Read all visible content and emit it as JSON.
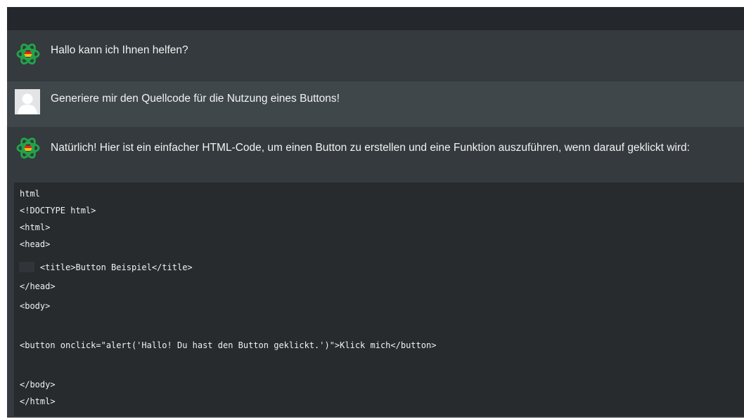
{
  "chat": {
    "messages": [
      {
        "role": "assistant",
        "text": "Hallo kann ich Ihnen helfen?"
      },
      {
        "role": "user",
        "text": "Generiere mir den Quellcode für die Nutzung eines Buttons!"
      },
      {
        "role": "assistant",
        "text": "Natürlich! Hier ist ein einfacher HTML-Code, um einen Button zu erstellen und eine Funktion auszuführen, wenn darauf geklickt wird:"
      }
    ],
    "code_block": {
      "language": "html",
      "lines": [
        "<!DOCTYPE html>",
        "<html>",
        "<head>",
        "    <title>Button Beispiel</title>",
        "</head>",
        "<body>",
        "",
        "<button onclick=\"alert('Hallo! Du hast den Button geklickt.')\">Klick mich</button>",
        "",
        "</body>",
        "</html>"
      ]
    }
  },
  "icons": {
    "assistant_avatar": "openai-logo-icon",
    "user_avatar": "default-user-icon"
  },
  "colors": {
    "assistant_bg": "#343a3d",
    "user_bg": "#40474b",
    "code_bg": "#272b2e",
    "topbar_bg": "#24272c",
    "logo_green": "#22a34a",
    "logo_flag_black": "#111111",
    "logo_flag_red": "#d7261e",
    "logo_flag_gold": "#f4c20d"
  }
}
